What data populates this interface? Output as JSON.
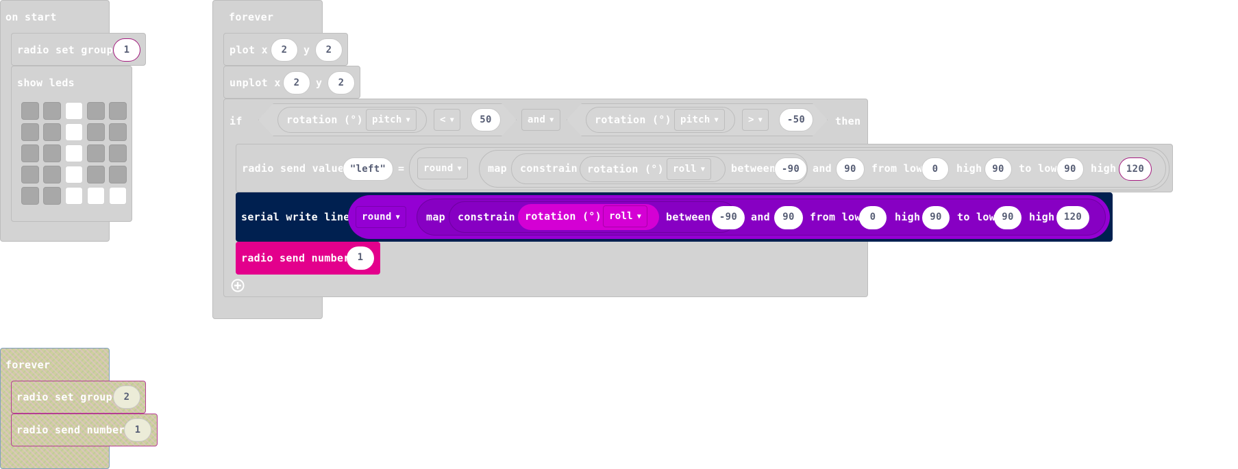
{
  "on_start": {
    "hat_label": "on start",
    "radio_set_group": {
      "label": "radio set group",
      "value": "1"
    },
    "show_leds": {
      "label": "show leds",
      "grid": [
        [
          0,
          0,
          1,
          0,
          0
        ],
        [
          0,
          0,
          1,
          0,
          0
        ],
        [
          0,
          0,
          1,
          0,
          0
        ],
        [
          0,
          0,
          1,
          0,
          0
        ],
        [
          0,
          0,
          1,
          1,
          1
        ]
      ]
    }
  },
  "forever_main": {
    "hat_label": "forever",
    "plot": {
      "label": "plot x",
      "x": "2",
      "y_label": "y",
      "y": "2"
    },
    "unplot": {
      "label": "unplot x",
      "x": "2",
      "y_label": "y",
      "y": "2"
    },
    "if_block": {
      "if_label": "if",
      "then_label": "then",
      "left_cond": {
        "sensor": "rotation (°)",
        "axis": "pitch",
        "op": "<",
        "value": "50"
      },
      "and_label": "and",
      "right_cond": {
        "sensor": "rotation (°)",
        "axis": "pitch",
        "op": ">",
        "value": "-50"
      }
    },
    "radio_send_value": {
      "label": "radio send value",
      "name": "\"left\"",
      "equals": "=",
      "round": "round",
      "map": "map",
      "constrain": "constrain",
      "sensor": "rotation (°)",
      "axis": "roll",
      "between": "between",
      "low": "-90",
      "and": "and",
      "high": "90",
      "from_low_label": "from low",
      "from_low": "0",
      "high_label": "high",
      "from_high": "90",
      "to_low_label": "to low",
      "to_low": "90",
      "to_high_label": "high",
      "to_high": "120"
    },
    "serial_write_line": {
      "label": "serial write line",
      "round": "round",
      "map": "map",
      "constrain": "constrain",
      "sensor": "rotation (°)",
      "axis": "roll",
      "between": "between",
      "low": "-90",
      "and": "and",
      "high": "90",
      "from_low_label": "from low",
      "from_low": "0",
      "high_label": "high",
      "from_high": "90",
      "to_low_label": "to low",
      "to_low": "90",
      "to_high_label": "high",
      "to_high": "120"
    },
    "radio_send_number": {
      "label": "radio send number",
      "value": "1"
    }
  },
  "forever_disabled": {
    "hat_label": "forever",
    "radio_set_group": {
      "label": "radio set group",
      "value": "2"
    },
    "radio_send_number": {
      "label": "radio send number",
      "value": "1"
    }
  },
  "colors": {
    "disabled_block": "#d3d3d3",
    "serial_block": "#002050",
    "math_round": "#9400d3",
    "sensor_block": "#d400d4",
    "radio_block": "#e3008c",
    "field_text": "#575e75"
  },
  "icons": {
    "add": "plus-circle-icon",
    "dropdown": "caret-down-icon"
  }
}
